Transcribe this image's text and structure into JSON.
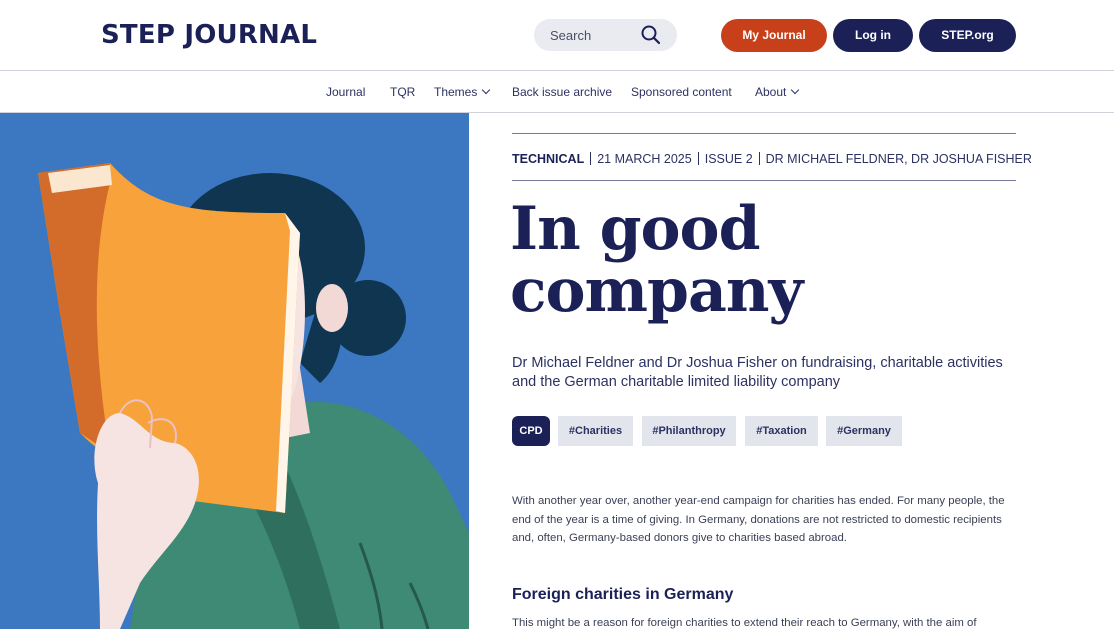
{
  "header": {
    "logo": "STEP JOURNAL",
    "search_placeholder": "Search",
    "buttons": {
      "my_journal": "My Journal",
      "login": "Log in",
      "step_org": "STEP.org"
    }
  },
  "nav": {
    "items": [
      "Journal",
      "TQR",
      "Themes",
      "Back issue archive",
      "Sponsored content",
      "About"
    ]
  },
  "article": {
    "category": "TECHNICAL",
    "date": "21 MARCH 2025",
    "issue": "ISSUE 2",
    "authors": "DR MICHAEL FELDNER, DR JOSHUA FISHER",
    "title_line1": "In good",
    "title_line2": "company",
    "standfirst": "Dr Michael Feldner and Dr Joshua Fisher on fundraising, charitable activities and the German charitable limited liability company",
    "tags": [
      "CPD",
      "#Charities",
      "#Philanthropy",
      "#Taxation",
      "#Germany"
    ],
    "intro": "With another year over, another year-end campaign for charities has ended. For many people, the end of the year is a time of giving. In Germany, donations are not restricted to domestic recipients and, often, Germany-based donors give to charities based abroad.",
    "subheading": "Foreign charities in Germany",
    "next_paragraph": "This might be a reason for foreign charities to extend their reach to Germany, with the aim of"
  },
  "colors": {
    "navy": "#1b2157",
    "accent_orange": "#c8401a",
    "hero_blue": "#3f7dc4"
  },
  "icons": [
    "search-icon",
    "chevron-down-icon"
  ]
}
